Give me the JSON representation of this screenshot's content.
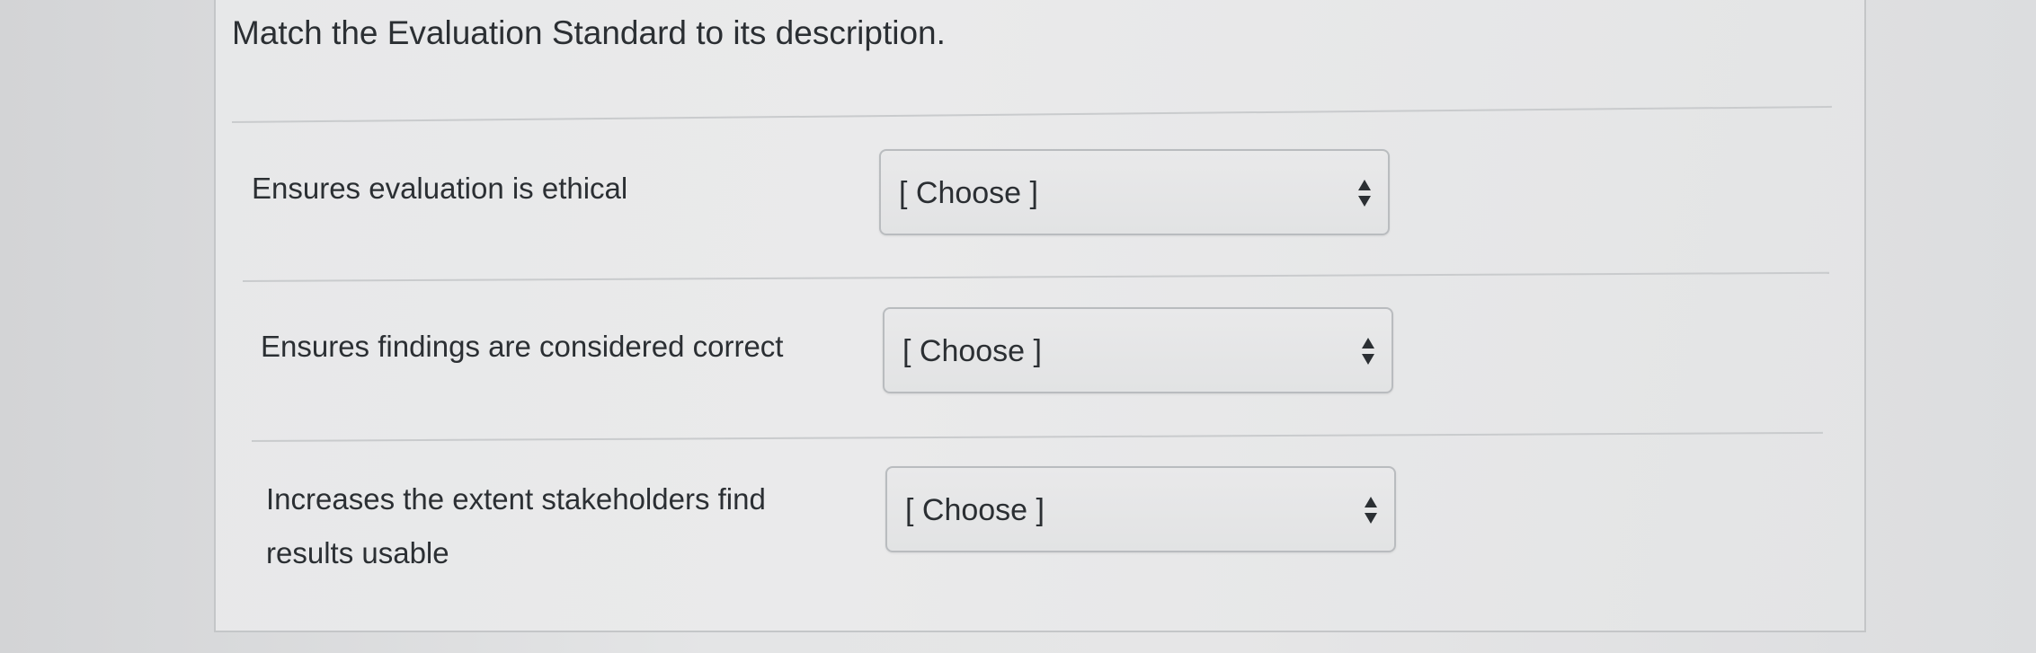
{
  "question": {
    "title": "Match the Evaluation Standard to its description."
  },
  "items": [
    {
      "label": "Ensures evaluation is ethical",
      "selected": "[ Choose ]"
    },
    {
      "label": "Ensures findings are considered correct",
      "selected": "[ Choose ]"
    },
    {
      "label": "Increases the extent stakeholders find results usable",
      "selected": "[ Choose ]"
    }
  ],
  "icons": {
    "dropdown": "updown-arrows-icon"
  },
  "colors": {
    "text": "#2b2f33",
    "card_background": "#e8e9ea",
    "border": "#b9bcbf"
  }
}
